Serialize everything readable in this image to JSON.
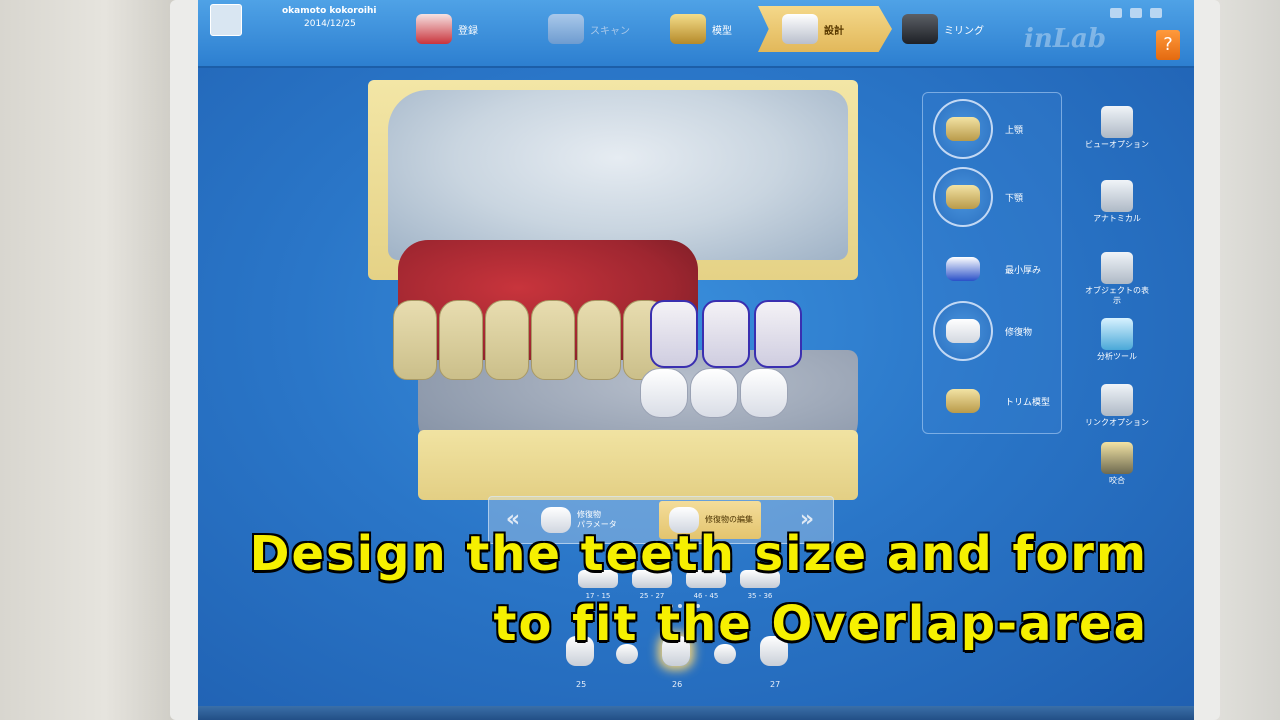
{
  "header": {
    "user_name": "okamoto kokoroihi",
    "date": "2014/12/25",
    "steps": [
      {
        "label": "登録",
        "state": "normal"
      },
      {
        "label": "スキャン",
        "state": "dim"
      },
      {
        "label": "模型",
        "state": "normal"
      },
      {
        "label": "設計",
        "state": "active"
      },
      {
        "label": "ミリング",
        "state": "normal"
      }
    ],
    "brand": "inLab",
    "help_label": "?"
  },
  "objects": [
    {
      "label": "上顎",
      "icon": "upper-jaw-icon"
    },
    {
      "label": "下顎",
      "icon": "lower-jaw-icon"
    },
    {
      "label": "最小厚み",
      "icon": "min-thickness-icon"
    },
    {
      "label": "修復物",
      "icon": "restoration-icon"
    },
    {
      "label": "トリム模型",
      "icon": "trim-model-icon"
    }
  ],
  "tools": [
    {
      "label": "ビューオプション",
      "icon": "view-options-icon"
    },
    {
      "label": "アナトミカル",
      "icon": "anatomical-icon"
    },
    {
      "label": "オブジェクトの表示",
      "icon": "object-display-icon"
    },
    {
      "label": "分析ツール",
      "icon": "analysis-tool-icon"
    },
    {
      "label": "リンクオプション",
      "icon": "link-options-icon"
    },
    {
      "label": "咬合",
      "icon": "occlusion-icon"
    }
  ],
  "step_nav": {
    "prev": "«",
    "next": "»",
    "items": [
      {
        "label": "修復物\nパラメータ",
        "active": false
      },
      {
        "label": "修復物の編集",
        "active": true
      }
    ]
  },
  "tooth_groups": [
    "17 - 15",
    "25 - 27",
    "46 - 45",
    "35 - 36"
  ],
  "bottom_teeth": [
    {
      "label": "25",
      "selected": false
    },
    {
      "label": "26",
      "selected": true
    },
    {
      "label": "27",
      "selected": false
    }
  ],
  "caption": {
    "line1": "Design the teeth size and form",
    "line2": "to fit the Overlap-area"
  },
  "colors": {
    "screen_blue": "#2a76c8",
    "active_step": "#e2b85a",
    "caption_yellow": "#f6f000",
    "crown_outline": "#3a2fb0"
  }
}
